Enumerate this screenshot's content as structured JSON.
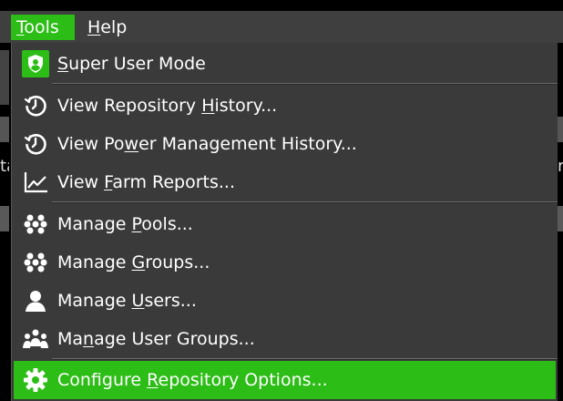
{
  "menubar": {
    "tools": {
      "pre": "",
      "u": "T",
      "post": "ools"
    },
    "help": {
      "pre": "",
      "u": "H",
      "post": "elp"
    }
  },
  "background": {
    "left_text": "ta",
    "right_text": "r"
  },
  "menu": {
    "items": [
      {
        "pre": "",
        "u": "S",
        "post": "uper User Mode",
        "icon": "shield-user-icon"
      },
      {
        "pre": "View Repository ",
        "u": "H",
        "post": "istory...",
        "icon": "clock-history-icon"
      },
      {
        "pre": "View Po",
        "u": "w",
        "post": "er Management History...",
        "icon": "clock-history-icon"
      },
      {
        "pre": "View ",
        "u": "F",
        "post": "arm Reports...",
        "icon": "line-chart-icon"
      },
      {
        "pre": "Manage ",
        "u": "P",
        "post": "ools...",
        "icon": "cluster-icon"
      },
      {
        "pre": "Manage ",
        "u": "G",
        "post": "roups...",
        "icon": "cluster-icon"
      },
      {
        "pre": "Manage ",
        "u": "U",
        "post": "sers...",
        "icon": "user-icon"
      },
      {
        "pre": "Ma",
        "u": "n",
        "post": "age User Groups...",
        "icon": "user-group-icon"
      },
      {
        "pre": "Configure ",
        "u": "R",
        "post": "epository Options...",
        "icon": "gear-icon"
      }
    ]
  },
  "colors": {
    "accent": "#2cbd16",
    "menu_bg": "#3a3a3a",
    "menubar_bg": "#3f3f3f",
    "text": "#ffffff"
  }
}
